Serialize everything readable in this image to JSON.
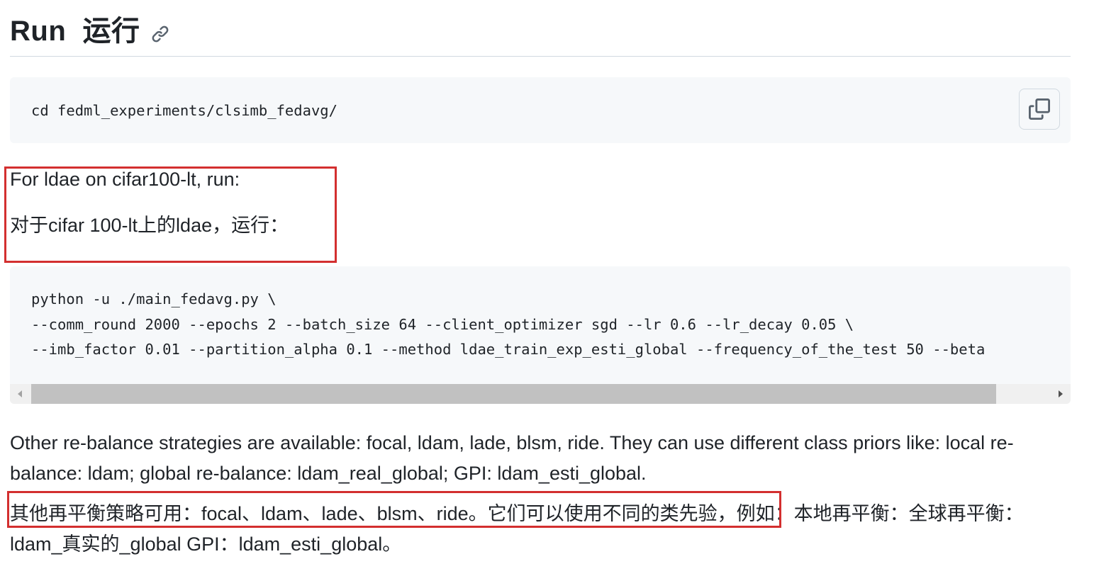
{
  "heading": {
    "text": "Run  运行",
    "anchor_icon": "link-icon"
  },
  "code_blocks": {
    "first": {
      "line": "cd fedml_experiments/clsimb_fedavg/",
      "copy_icon": "copy-icon"
    },
    "second": {
      "lines": [
        "python -u ./main_fedavg.py \\",
        "--comm_round 2000 --epochs 2 --batch_size 64 --client_optimizer sgd --lr 0.6 --lr_decay 0.05 \\",
        "--imb_factor 0.01 --partition_alpha 0.1 --method ldae_train_exp_esti_global --frequency_of_the_test 50 --beta"
      ]
    }
  },
  "paragraphs": {
    "en_1": "For ldae on cifar100-lt, run:",
    "zh_1": "对于cifar 100-lt上的ldae，运行：",
    "en_2": "Other re-balance strategies are available: focal, ldam, lade, blsm, ride. They can use different class priors like: local re-balance: ldam; global re-balance: ldam_real_global; GPI: ldam_esti_global.",
    "zh_2": "其他再平衡策略可用：focal、ldam、lade、blsm、ride。它们可以使用不同的类先验，例如：本地再平衡：全球再平衡：ldam_真实的_global GPI：ldam_esti_global。"
  },
  "colors": {
    "code_background": "#f6f8fa",
    "highlight_border": "#d32f2f",
    "text": "#1f2328",
    "rule": "#d1d9e0",
    "scroll_thumb": "#c1c1c1"
  }
}
